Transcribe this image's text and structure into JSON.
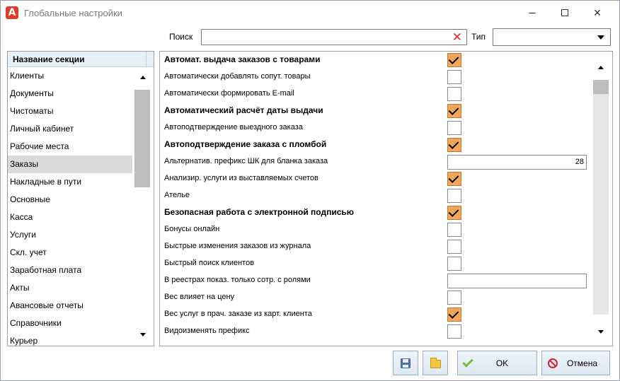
{
  "window": {
    "title": "Глобальные настройки",
    "app_icon_letter": "A"
  },
  "search": {
    "label": "Поиск",
    "value": "",
    "clear_icon": "close-x-icon"
  },
  "type_filter": {
    "label": "Тип",
    "value": ""
  },
  "sections": {
    "header": "Название секции",
    "selected": "Заказы",
    "items": [
      "Клиенты",
      "Документы",
      "Чистоматы",
      "Личный кабинет",
      "Рабочие места",
      "Заказы",
      "Накладные в пути",
      "Основные",
      "Касса",
      "Услуги",
      "Скл. учет",
      "Заработная плата",
      "Акты",
      "Авансовые отчеты",
      "Справочники",
      "Курьер"
    ]
  },
  "settings": [
    {
      "label": "Автомат. выдача заказов с товарами",
      "bold": true,
      "type": "checkbox",
      "checked": true
    },
    {
      "label": "Автоматически добавлять сопут. товары",
      "bold": false,
      "type": "checkbox",
      "checked": false
    },
    {
      "label": "Автоматически формировать E-mail",
      "bold": false,
      "type": "checkbox",
      "checked": false
    },
    {
      "label": "Автоматический расчёт даты выдачи",
      "bold": true,
      "type": "checkbox",
      "checked": true
    },
    {
      "label": "Автоподтверждение выездного заказа",
      "bold": false,
      "type": "checkbox",
      "checked": false
    },
    {
      "label": "Автоподтверждение заказа с пломбой",
      "bold": true,
      "type": "checkbox",
      "checked": true
    },
    {
      "label": "Альтернатив. префикс ШК для бланка заказа",
      "bold": false,
      "type": "number",
      "value": "28"
    },
    {
      "label": "Анализир. услуги из выставляемых счетов",
      "bold": false,
      "type": "checkbox",
      "checked": true
    },
    {
      "label": "Ателье",
      "bold": false,
      "type": "checkbox",
      "checked": false
    },
    {
      "label": "Безопасная работа с электронной подписью",
      "bold": true,
      "type": "checkbox",
      "checked": true
    },
    {
      "label": "Бонусы онлайн",
      "bold": false,
      "type": "checkbox",
      "checked": false
    },
    {
      "label": "Быстрые изменения заказов из журнала",
      "bold": false,
      "type": "checkbox",
      "checked": false
    },
    {
      "label": "Быстрый поиск клиентов",
      "bold": false,
      "type": "checkbox",
      "checked": false
    },
    {
      "label": "В реестрах показ. только сотр. с ролями",
      "bold": false,
      "type": "number",
      "value": ""
    },
    {
      "label": "Вес влияет на цену",
      "bold": false,
      "type": "checkbox",
      "checked": false
    },
    {
      "label": "Вес услуг в прач. заказе из карт. клиента",
      "bold": false,
      "type": "checkbox",
      "checked": true
    },
    {
      "label": "Видоизменять префикс",
      "bold": false,
      "type": "checkbox",
      "checked": false
    }
  ],
  "buttons": {
    "ok": "OK",
    "cancel": "Отмена"
  },
  "colors": {
    "checkbox_on": "#f2a65a",
    "selected_row": "#dadada",
    "header_bg": "#e8f0f7"
  }
}
